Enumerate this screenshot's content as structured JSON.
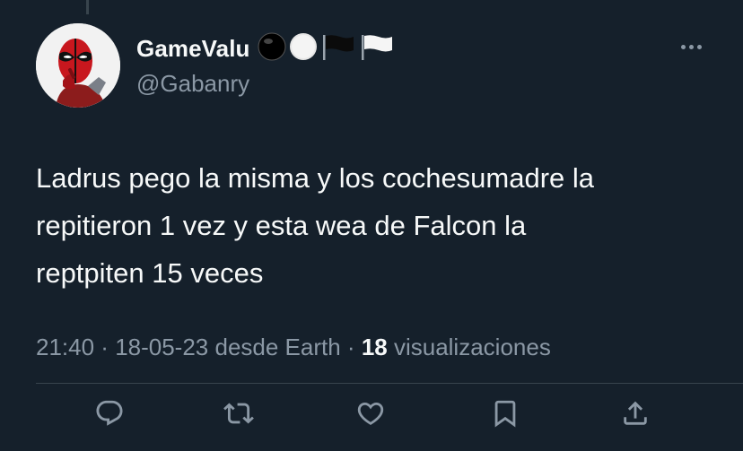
{
  "tweet": {
    "author": {
      "display_name": "GameValu",
      "handle": "@Gabanry",
      "avatar_icon": "deadpool-avatar",
      "name_emojis": [
        "black-circle-emoji",
        "white-circle-emoji",
        "black-flag-emoji",
        "white-flag-emoji"
      ]
    },
    "text_lines": [
      "Ladrus pego la misma y los cochesumadre la",
      "repitieron 1 vez y esta wea de Falcon la",
      "reptpiten 15 veces"
    ],
    "meta": {
      "time": "21:40",
      "separator": " · ",
      "date": "18-05-23",
      "source": " desde Earth",
      "views_count": "18",
      "views_label": " visualizaciones"
    },
    "actions": [
      {
        "name": "reply-button",
        "icon": "reply-icon"
      },
      {
        "name": "retweet-button",
        "icon": "retweet-icon"
      },
      {
        "name": "like-button",
        "icon": "heart-icon"
      },
      {
        "name": "bookmark-button",
        "icon": "bookmark-icon"
      },
      {
        "name": "share-button",
        "icon": "share-icon"
      }
    ]
  },
  "colors": {
    "background": "#15202b",
    "text_primary": "#f7f9f9",
    "text_secondary": "#8b98a5",
    "divider": "#38444d"
  }
}
